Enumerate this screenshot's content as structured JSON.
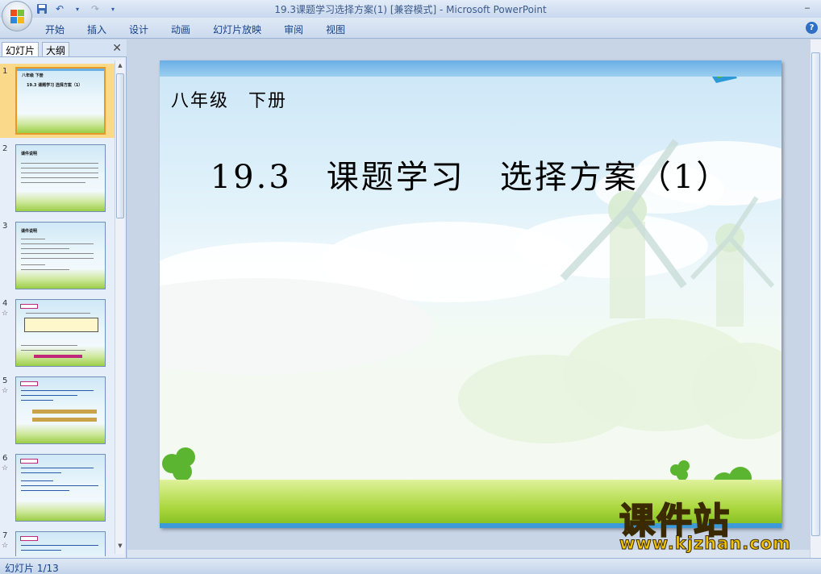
{
  "window": {
    "title": "19.3课题学习选择方案(1) [兼容模式] - Microsoft PowerPoint"
  },
  "ribbon": {
    "tabs": [
      "开始",
      "插入",
      "设计",
      "动画",
      "幻灯片放映",
      "审阅",
      "视图"
    ]
  },
  "pane": {
    "tabs": [
      "幻灯片",
      "大纲"
    ],
    "thumbnails": [
      {
        "num": "1",
        "star": "",
        "label": "19.3 课题学习 选择方案（1）"
      },
      {
        "num": "2",
        "star": "",
        "label": "课件说明"
      },
      {
        "num": "3",
        "star": "",
        "label": "课件说明"
      },
      {
        "num": "4",
        "star": "☆",
        "label": ""
      },
      {
        "num": "5",
        "star": "☆",
        "label": ""
      },
      {
        "num": "6",
        "star": "☆",
        "label": ""
      },
      {
        "num": "7",
        "star": "☆",
        "label": ""
      }
    ]
  },
  "slide": {
    "grade": "八年级　下册",
    "title": "19.3　课题学习　选择方案（1）"
  },
  "status": {
    "text": "幻灯片 1/13"
  },
  "watermark": {
    "brand": "课件站",
    "url": "www.kjzhan.com"
  },
  "colors": {
    "accent": "#15428b",
    "ribbon": "#cbdaee",
    "selected_thumb": "#fbd98a",
    "watermark": "#f2c300"
  }
}
